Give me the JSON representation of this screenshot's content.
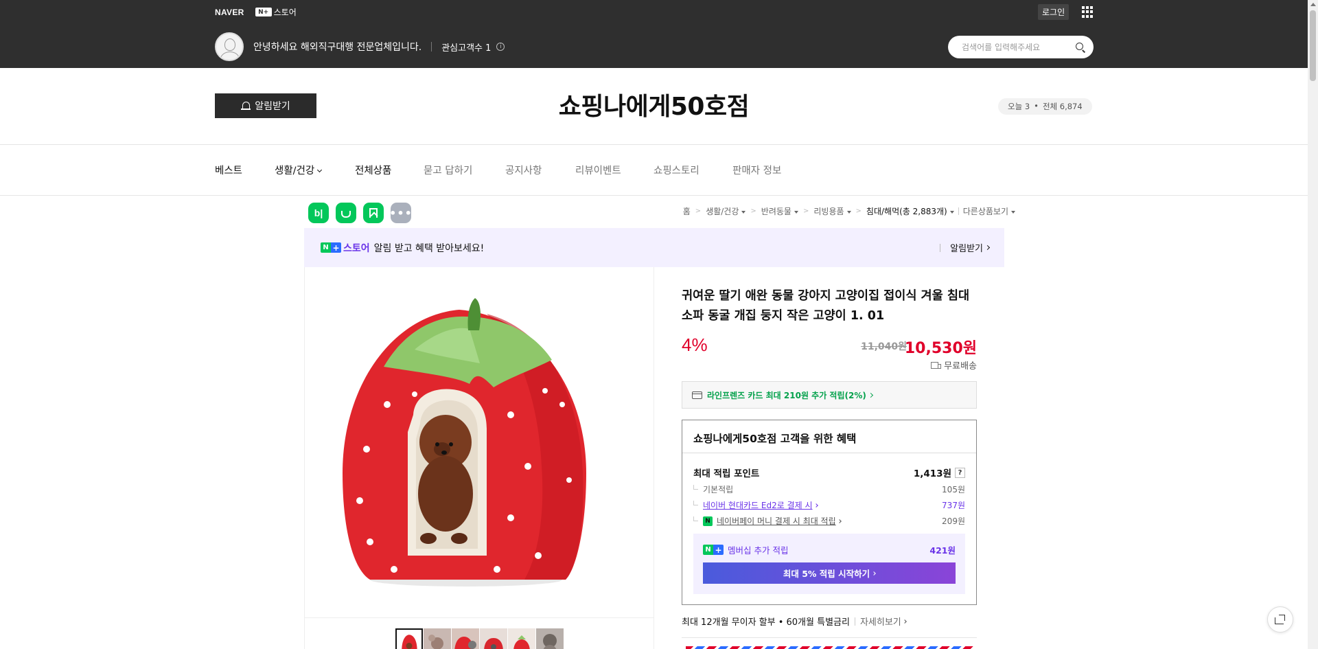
{
  "gnb": {
    "naver_logo": "NAVER",
    "nplus_badge": "N+",
    "nplus_store": "스토어",
    "login": "로그인"
  },
  "profile": {
    "greeting": "안녕하세요 해외직구대행 전문업체입니다.",
    "followers": "관심고객수 1"
  },
  "search": {
    "placeholder": "검색어를 입력해주세요"
  },
  "store": {
    "alarm_button": "알림받기",
    "name": "쇼핑나에게50호점",
    "visit_today": "오늘 3",
    "visit_dot": "•",
    "visit_total": "전체 6,874"
  },
  "nav": {
    "items": [
      "베스트",
      "생활/건강",
      "전체상품",
      "묻고 답하기",
      "공지사항",
      "리뷰이벤트",
      "쇼핑스토리",
      "판매자 정보"
    ]
  },
  "icons": {
    "blog": "b|",
    "more": "•••"
  },
  "breadcrumb": {
    "home": "홈",
    "c1": "생활/건강",
    "c2": "반려동물",
    "c3": "리빙용품",
    "c4": "침대/해먹(총 2,883개)",
    "other": "다른상품보기"
  },
  "promo": {
    "n": "N",
    "plus": "+",
    "store": "스토어",
    "text": "알림 받고 혜택 받아보세요!",
    "link": "알림받기"
  },
  "product": {
    "title": "귀여운 딸기 애완 동물 강아지 고양이집 접이식 겨울 침대 소파 동굴 개집 둥지 작은 고양이 1. 01",
    "discount": "4%",
    "original_price": "11,040원",
    "sale_price": "10,530원",
    "shipping": "무료배송",
    "card_benefit": "라인프렌즈 카드 최대 210원 추가 적립(2%)"
  },
  "benefits": {
    "title": "쇼핑나에게50호점 고객을 위한 혜택",
    "max_points_label": "최대 적립 포인트",
    "max_points_value": "1,413원",
    "help": "?",
    "basic_label": "기본적립",
    "basic_value": "105원",
    "hyundai_label": "네이버 현대카드 Ed2로 결제 시",
    "hyundai_value": "737원",
    "npay_badge": "N",
    "npay_label": "네이버페이 머니 결제 시 최대 적립",
    "npay_value": "209원",
    "membership_label": "멤버십 추가 적립",
    "membership_value": "421원",
    "membership_button": "최대 5% 적립 시작하기"
  },
  "installment": {
    "text": "최대 12개월 무이자 할부 • 60개월 특별금리",
    "more": "자세히보기"
  }
}
